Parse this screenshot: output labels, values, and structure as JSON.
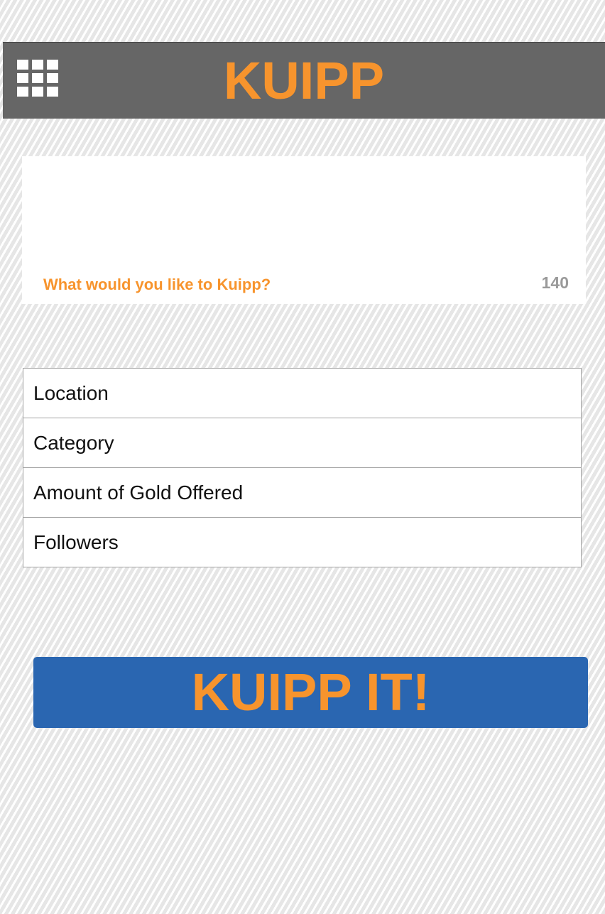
{
  "header": {
    "menu_icon": "grid-menu-icon",
    "title": "KUIPP"
  },
  "compose": {
    "placeholder": "What would you like to Kuipp?",
    "char_count": "140"
  },
  "options": [
    {
      "label": "Location"
    },
    {
      "label": "Category"
    },
    {
      "label": "Amount of Gold Offered"
    },
    {
      "label": "Followers"
    }
  ],
  "submit": {
    "label": "KUIPP IT!"
  },
  "colors": {
    "brand_orange": "#f7942d",
    "header_gray": "#666666",
    "button_blue": "#2a66b1"
  }
}
